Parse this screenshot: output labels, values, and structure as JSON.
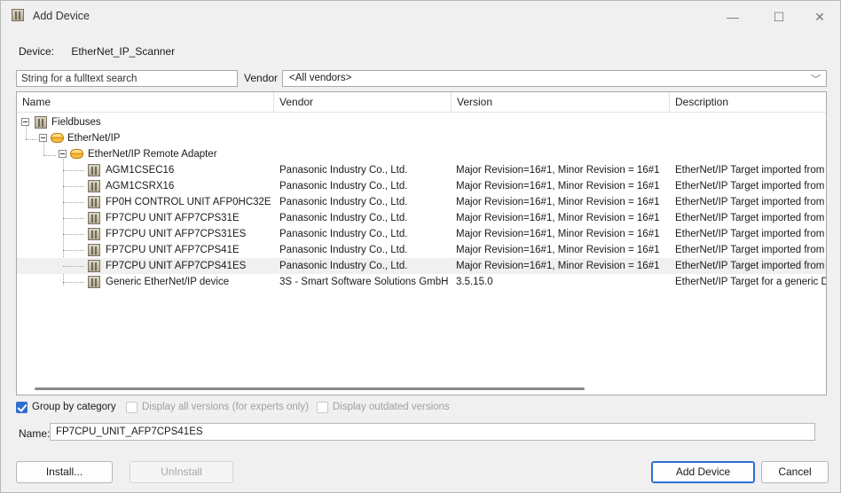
{
  "window": {
    "title": "Add Device",
    "minimize": "—",
    "maximize": "☐",
    "close": "✕"
  },
  "device": {
    "label": "Device:",
    "value": "EtherNet_IP_Scanner"
  },
  "search": {
    "placeholder": "String for a fulltext search"
  },
  "vendor": {
    "label": "Vendor",
    "selected": "<All vendors>",
    "chevron": "﹀"
  },
  "tree": {
    "columns": {
      "name": "Name",
      "vendor": "Vendor",
      "version": "Version",
      "description": "Description"
    },
    "root": "Fieldbuses",
    "group": "EtherNet/IP",
    "subgroup": "EtherNet/IP Remote Adapter",
    "rows": [
      {
        "name": "AGM1CSEC16",
        "vendor": "Panasonic Industry Co., Ltd.",
        "version": "Major Revision=16#1, Minor Revision = 16#1",
        "description": "EtherNet/IP Target imported from El"
      },
      {
        "name": "AGM1CSRX16",
        "vendor": "Panasonic Industry Co., Ltd.",
        "version": "Major Revision=16#1, Minor Revision = 16#1",
        "description": "EtherNet/IP Target imported from El"
      },
      {
        "name": "FP0H CONTROL UNIT AFP0HC32E",
        "vendor": "Panasonic Industry Co., Ltd.",
        "version": "Major Revision=16#1, Minor Revision = 16#1",
        "description": "EtherNet/IP Target imported from El"
      },
      {
        "name": "FP7CPU UNIT AFP7CPS31E",
        "vendor": "Panasonic Industry Co., Ltd.",
        "version": "Major Revision=16#1, Minor Revision = 16#1",
        "description": "EtherNet/IP Target imported from El"
      },
      {
        "name": "FP7CPU UNIT AFP7CPS31ES",
        "vendor": "Panasonic Industry Co., Ltd.",
        "version": "Major Revision=16#1, Minor Revision = 16#1",
        "description": "EtherNet/IP Target imported from El"
      },
      {
        "name": "FP7CPU UNIT AFP7CPS41E",
        "vendor": "Panasonic Industry Co., Ltd.",
        "version": "Major Revision=16#1, Minor Revision = 16#1",
        "description": "EtherNet/IP Target imported from El"
      },
      {
        "name": "FP7CPU UNIT AFP7CPS41ES",
        "vendor": "Panasonic Industry Co., Ltd.",
        "version": "Major Revision=16#1, Minor Revision = 16#1",
        "description": "EtherNet/IP Target imported from El"
      }
    ],
    "generic": {
      "name": "Generic EtherNet/IP device",
      "vendor": "3S - Smart Software Solutions GmbH",
      "version": "3.5.15.0",
      "description": "EtherNet/IP Target for a generic De"
    },
    "selected_row": "FP7CPU UNIT AFP7CPS41ES"
  },
  "options": {
    "group_by_category": {
      "label": "Group by category",
      "checked": true
    },
    "display_all_versions": {
      "label": "Display all versions (for experts only)",
      "checked": false
    },
    "display_outdated": {
      "label": "Display outdated versions",
      "checked": false
    }
  },
  "name_field": {
    "label": "Name:",
    "value": "FP7CPU_UNIT_AFP7CPS41ES"
  },
  "buttons": {
    "install": "Install...",
    "uninstall": "UnInstall",
    "add_device": "Add Device",
    "cancel": "Cancel"
  },
  "colors": {
    "accent": "#2f6fd0",
    "background": "#f0f0f0"
  }
}
